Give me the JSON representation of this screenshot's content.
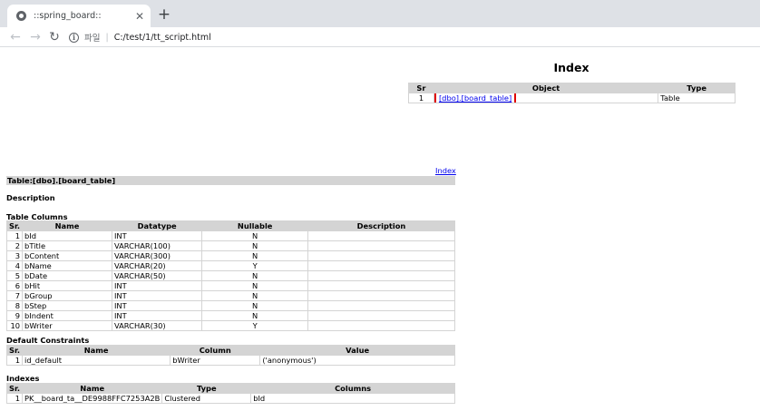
{
  "browser": {
    "tab_title": "::spring_board::",
    "close_glyph": "✕",
    "newtab_glyph": "+",
    "back_glyph": "←",
    "forward_glyph": "→",
    "reload_glyph": "↻",
    "info_glyph": "i",
    "address_protocol": "파일",
    "address_separator": "|",
    "address_url": "C:/test/1/tt_script.html"
  },
  "index": {
    "title": "Index",
    "headers": [
      "Sr",
      "Object",
      "Type"
    ],
    "rows": [
      {
        "sr": "1",
        "object": "[dbo].[board_table]",
        "type": "Table"
      }
    ],
    "highlight_color": "#e00000"
  },
  "table_section": {
    "index_link": "Index",
    "title": "Table:[dbo].[board_table]",
    "description_heading": "Description",
    "columns_heading": "Table Columns",
    "columns_headers": [
      "Sr.",
      "Name",
      "Datatype",
      "Nullable",
      "Description"
    ],
    "columns": [
      {
        "sr": "1",
        "name": "bId",
        "type": "INT",
        "nullable": "N",
        "desc": ""
      },
      {
        "sr": "2",
        "name": "bTitle",
        "type": "VARCHAR(100)",
        "nullable": "N",
        "desc": ""
      },
      {
        "sr": "3",
        "name": "bContent",
        "type": "VARCHAR(300)",
        "nullable": "N",
        "desc": ""
      },
      {
        "sr": "4",
        "name": "bName",
        "type": "VARCHAR(20)",
        "nullable": "Y",
        "desc": ""
      },
      {
        "sr": "5",
        "name": "bDate",
        "type": "VARCHAR(50)",
        "nullable": "N",
        "desc": ""
      },
      {
        "sr": "6",
        "name": "bHit",
        "type": "INT",
        "nullable": "N",
        "desc": ""
      },
      {
        "sr": "7",
        "name": "bGroup",
        "type": "INT",
        "nullable": "N",
        "desc": ""
      },
      {
        "sr": "8",
        "name": "bStep",
        "type": "INT",
        "nullable": "N",
        "desc": ""
      },
      {
        "sr": "9",
        "name": "bIndent",
        "type": "INT",
        "nullable": "N",
        "desc": ""
      },
      {
        "sr": "10",
        "name": "bWriter",
        "type": "VARCHAR(30)",
        "nullable": "Y",
        "desc": ""
      }
    ],
    "constraints_heading": "Default Constraints",
    "constraints_headers": [
      "Sr.",
      "Name",
      "Column",
      "Value"
    ],
    "constraints": [
      {
        "sr": "1",
        "name": "id_default",
        "column": "bWriter",
        "value": "('anonymous')"
      }
    ],
    "indexes_heading": "Indexes",
    "indexes_headers": [
      "Sr.",
      "Name",
      "Type",
      "Columns"
    ],
    "indexes": [
      {
        "sr": "1",
        "name": "PK__board_ta__DE9988FFC7253A2B",
        "type": "Clustered",
        "columns": "bId"
      }
    ]
  }
}
